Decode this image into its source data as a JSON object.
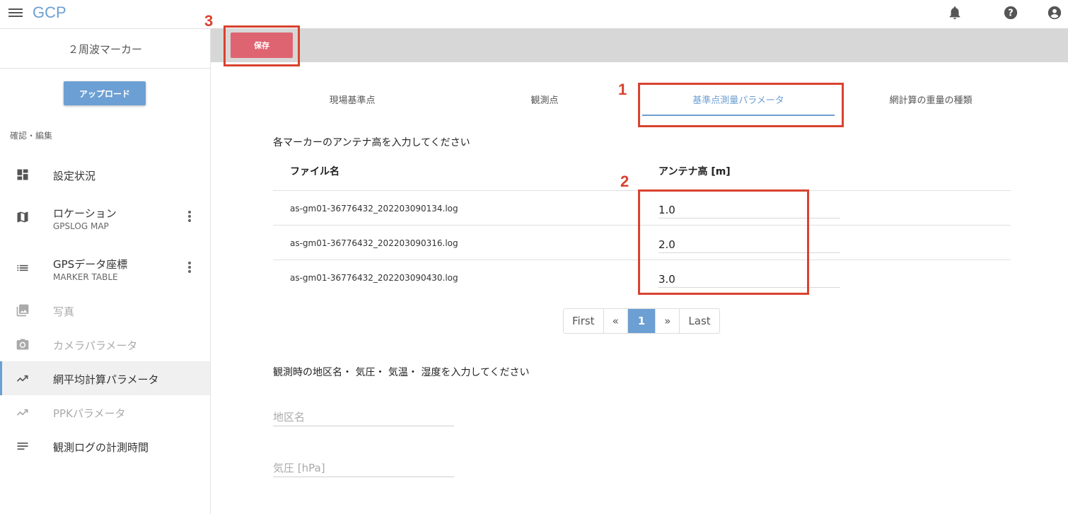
{
  "app": {
    "title": "GCP"
  },
  "sidebar": {
    "project_name": "２周波マーカー",
    "upload_label": "アップロード",
    "section_label": "確認・編集",
    "items": [
      {
        "label": "設定状況",
        "icon": "dashboard-icon"
      },
      {
        "label": "ロケーション",
        "sub": "GPSLOG MAP",
        "icon": "map-icon"
      },
      {
        "label": "GPSデータ座標",
        "sub": "MARKER TABLE",
        "icon": "list-icon"
      },
      {
        "label": "写真",
        "icon": "photo-icon",
        "disabled": true
      },
      {
        "label": "カメラパラメータ",
        "icon": "camera-icon",
        "disabled": true
      },
      {
        "label": "網平均計算パラメータ",
        "icon": "trending-icon",
        "active": true
      },
      {
        "label": "PPKパラメータ",
        "icon": "trending-icon",
        "disabled": true
      },
      {
        "label": "観測ログの計測時間",
        "icon": "notes-icon"
      }
    ]
  },
  "toolbar": {
    "save_label": "保存"
  },
  "annotations": [
    "1",
    "2",
    "3"
  ],
  "tabs": [
    {
      "label": "現場基準点"
    },
    {
      "label": "観測点"
    },
    {
      "label": "基準点測量パラメータ",
      "active": true
    },
    {
      "label": "網計算の重量の種類"
    }
  ],
  "antenna": {
    "instruction": "各マーカーのアンテナ高を入力してください",
    "col_file": "ファイル名",
    "col_height": "アンテナ高 [m]",
    "rows": [
      {
        "file": "as-gm01-36776432_202203090134.log",
        "height": "1.0"
      },
      {
        "file": "as-gm01-36776432_202203090316.log",
        "height": "2.0"
      },
      {
        "file": "as-gm01-36776432_202203090430.log",
        "height": "3.0"
      }
    ]
  },
  "pagination": {
    "first": "First",
    "prev": "«",
    "current": "1",
    "next": "»",
    "last": "Last"
  },
  "observation": {
    "instruction": "観測時の地区名・ 気圧・ 気温・ 湿度を入力してください",
    "fields": [
      {
        "placeholder": "地区名"
      },
      {
        "placeholder": "気圧 [hPa]"
      }
    ]
  },
  "colors": {
    "accent": "#6c9fd3",
    "save": "#df6471",
    "annotation": "#d9422f"
  }
}
